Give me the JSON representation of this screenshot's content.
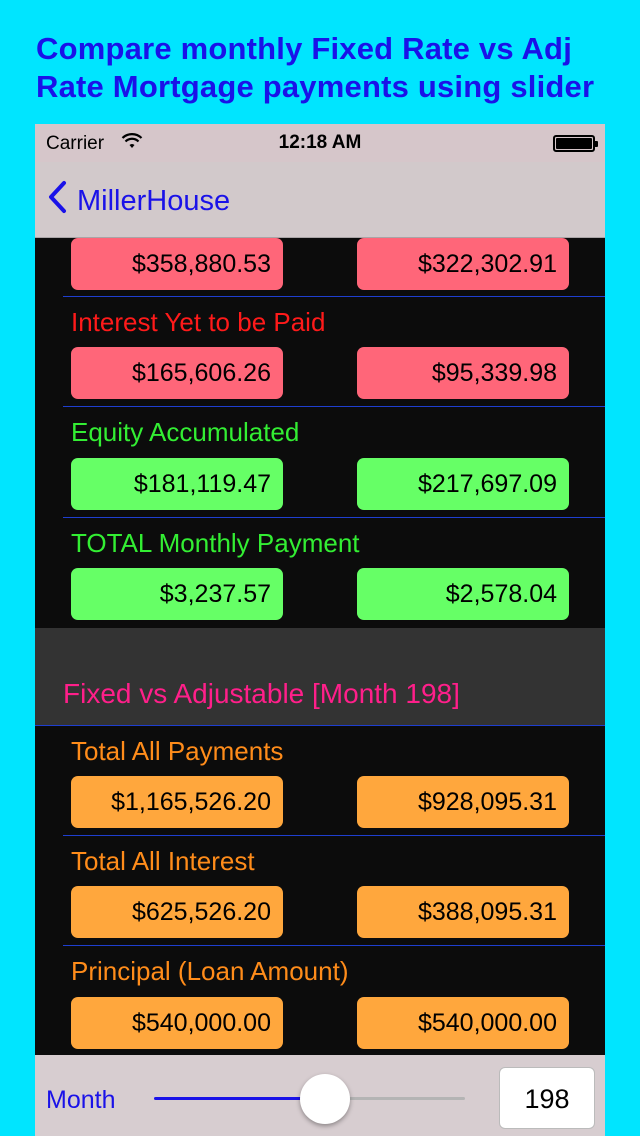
{
  "banner": {
    "line1": "Compare monthly Fixed Rate vs Adj",
    "line2": "Rate Mortgage payments using slider"
  },
  "status_bar": {
    "carrier": "Carrier",
    "wifi_icon": "wifi-icon",
    "time": "12:18 AM",
    "battery_icon": "battery-icon"
  },
  "nav": {
    "back_label": "MillerHouse",
    "back_icon": "chevron-left-icon"
  },
  "top_rows": [
    {
      "label": "",
      "fixed": "$358,880.53",
      "adjustable": "$322,302.91",
      "color": "red"
    },
    {
      "label": "Interest Yet to be Paid",
      "fixed": "$165,606.26",
      "adjustable": "$95,339.98",
      "color": "red"
    },
    {
      "label": "Equity Accumulated",
      "fixed": "$181,119.47",
      "adjustable": "$217,697.09",
      "color": "green"
    },
    {
      "label": "TOTAL Monthly Payment",
      "fixed": "$3,237.57",
      "adjustable": "$2,578.04",
      "color": "green"
    }
  ],
  "section": {
    "title": "Fixed  vs  Adjustable [Month 198]"
  },
  "bottom_rows": [
    {
      "label": "Total All Payments",
      "fixed": "$1,165,526.20",
      "adjustable": "$928,095.31",
      "color": "orange"
    },
    {
      "label": "Total All Interest",
      "fixed": "$625,526.20",
      "adjustable": "$388,095.31",
      "color": "orange"
    },
    {
      "label": "Principal (Loan Amount)",
      "fixed": "$540,000.00",
      "adjustable": "$540,000.00",
      "color": "orange"
    }
  ],
  "toolbar": {
    "month_label": "Month",
    "month_value": "198",
    "slider_fraction": 0.55
  },
  "colors": {
    "background": "#00e5ff",
    "accent": "#1a12e8",
    "section_title": "#ff1f8a"
  }
}
